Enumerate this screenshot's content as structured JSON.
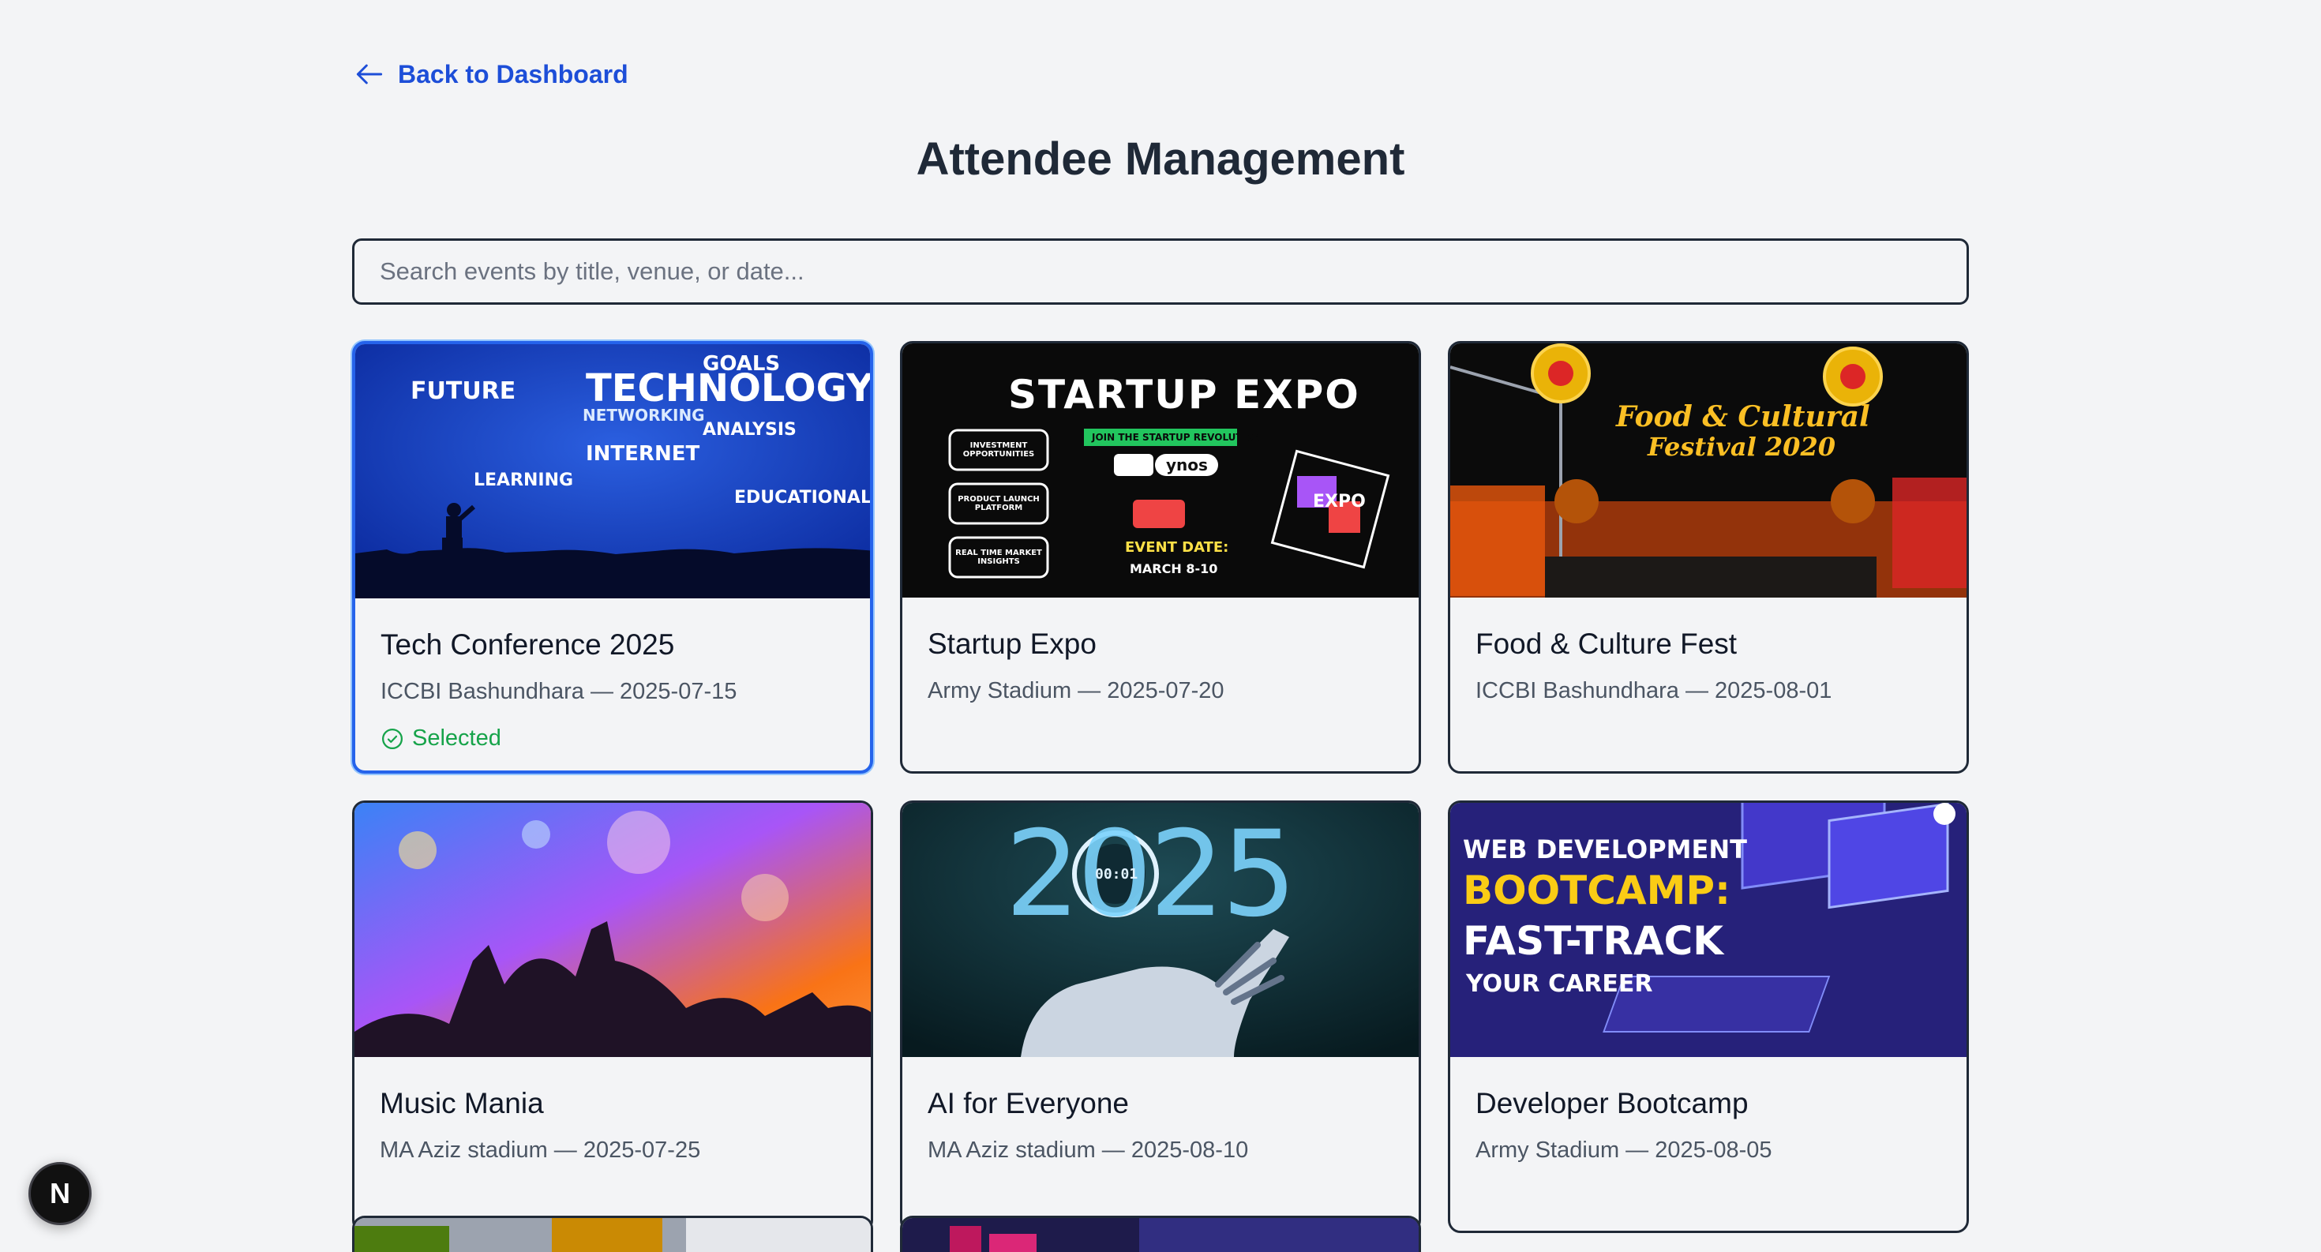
{
  "nav": {
    "back_label": "Back to Dashboard"
  },
  "page": {
    "title": "Attendee Management"
  },
  "search": {
    "placeholder": "Search events by title, venue, or date..."
  },
  "events": [
    {
      "title": "Tech Conference 2025",
      "meta": "ICCBI Bashundhara — 2025-07-15",
      "selected": true,
      "selected_label": "Selected"
    },
    {
      "title": "Startup Expo",
      "meta": "Army Stadium — 2025-07-20",
      "selected": false
    },
    {
      "title": "Food & Culture Fest",
      "meta": "ICCBI Bashundhara — 2025-08-01",
      "selected": false
    },
    {
      "title": "Music Mania",
      "meta": "MA Aziz stadium — 2025-07-25",
      "selected": false
    },
    {
      "title": "AI for Everyone",
      "meta": "MA Aziz stadium — 2025-08-10",
      "selected": false
    },
    {
      "title": "Developer Bootcamp",
      "meta": "Army Stadium — 2025-08-05",
      "selected": false
    }
  ],
  "thumb_text": {
    "tech": [
      "TECHNOLOGY",
      "FUTURE",
      "GOALS",
      "INTERNET",
      "LEARNING",
      "EDUCATIONAL",
      "NETWORKING",
      "ANALYSIS"
    ],
    "startup": {
      "title": "STARTUP EXPO",
      "pills": [
        "INVESTMENT OPPORTUNITIES",
        "PRODUCT LAUNCH PLATFORM",
        "REAL TIME MARKET INSIGHTS"
      ],
      "banner": "JOIN THE STARTUP REVOLUTION",
      "brand": "ynos",
      "date_label": "EVENT DATE:",
      "date": "MARCH 8-10",
      "side": "EXPO"
    },
    "food": {
      "line1": "Food & Cultural",
      "line2": "Festival 2020"
    },
    "ai": {
      "year": "2025",
      "counter": "00:01"
    },
    "dev": {
      "line1": "WEB DEVELOPMENT",
      "line2": "BOOTCAMP:",
      "line3": "FAST-TRACK",
      "line4": "YOUR CAREER"
    }
  },
  "dev_badge": {
    "label": "N"
  },
  "colors": {
    "accent": "#2563eb",
    "link": "#1d4ed8",
    "success": "#16a34a"
  }
}
